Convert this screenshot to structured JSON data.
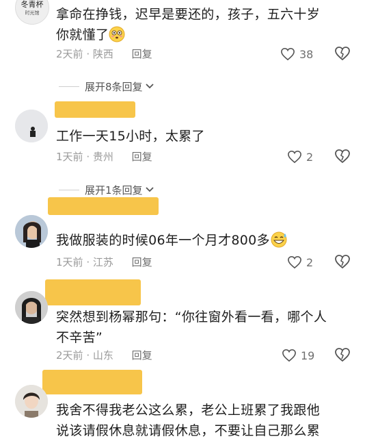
{
  "comments": [
    {
      "text_lines": [
        "拿命在挣钱，迟早是要还的，孩子，五六十岁",
        "你就懂了"
      ],
      "emoji": "😳",
      "time": "2天前",
      "location": "陕西",
      "reply_label": "回复",
      "likes": "38",
      "expand_label": "展开8条回复"
    },
    {
      "text_lines": [
        "工作一天15小时，太累了"
      ],
      "time": "1天前",
      "location": "贵州",
      "reply_label": "回复",
      "likes": "2",
      "expand_label": "展开1条回复"
    },
    {
      "text_lines": [
        "我做服装的时候06年一个月才800多"
      ],
      "emoji": "😅",
      "time": "1天前",
      "location": "江苏",
      "reply_label": "回复",
      "likes": "2"
    },
    {
      "text_lines": [
        "突然想到杨幂那句：“你往窗外看一看，哪个人",
        "不辛苦”"
      ],
      "time": "2天前",
      "location": "山东",
      "reply_label": "回复",
      "likes": "19"
    },
    {
      "text_lines": [
        "我舍不得我老公这么累，老公上班累了我跟他",
        "说该请假休息就请假休息，不要让自己那么累"
      ]
    }
  ],
  "avatar_texts": {
    "top_avatar_line1": "冬青杯",
    "top_avatar_line2": "时光馆"
  },
  "colors": {
    "highlight": "#f7c54a",
    "meta_gray": "#9a9a9a",
    "text": "#1e1e1e"
  },
  "icons": {
    "like": "heart-outline-icon",
    "dislike": "broken-heart-icon",
    "expand": "chevron-down-icon"
  }
}
